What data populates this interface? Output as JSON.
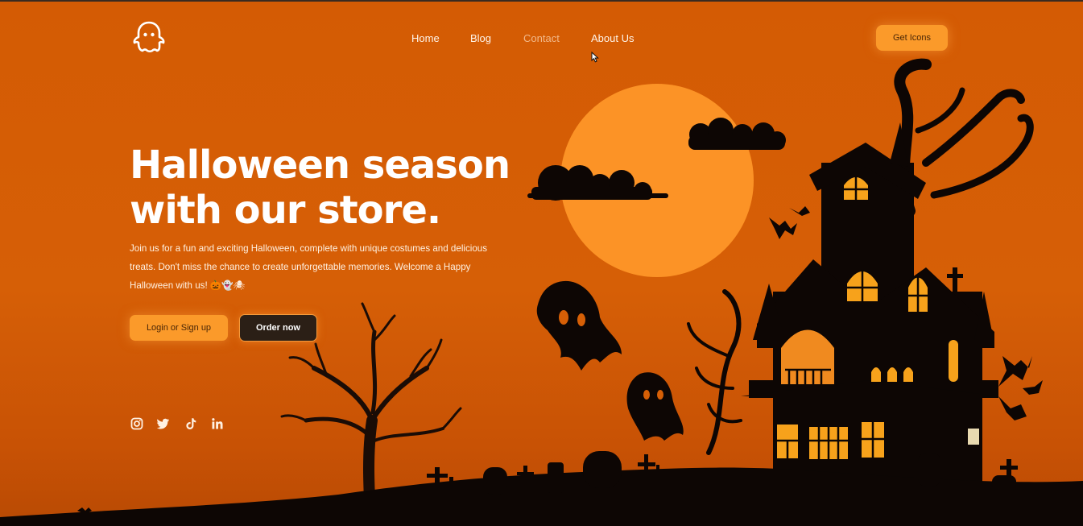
{
  "nav": {
    "links": [
      {
        "label": "Home"
      },
      {
        "label": "Blog"
      },
      {
        "label": "Contact"
      },
      {
        "label": "About Us"
      }
    ],
    "cta_label": "Get Icons"
  },
  "hero": {
    "title_line1": "Halloween season",
    "title_line2": "with our store.",
    "description": "Join us for a fun and exciting Halloween, complete with unique costumes and delicious treats. Don't miss the chance to create unforgettable memories. Welcome a Happy Halloween with us! 🎃👻🕷",
    "primary_button": "Login or Sign up",
    "secondary_button": "Order now"
  },
  "social": [
    "instagram-icon",
    "twitter-icon",
    "tiktok-icon",
    "linkedin-icon"
  ],
  "colors": {
    "background": "#d45b04",
    "accent": "#fb9a2a",
    "moon": "#fc9326",
    "silhouette": "#0d0604",
    "window_glow": "#f7a21b",
    "dark_button": "#2b1f16"
  }
}
